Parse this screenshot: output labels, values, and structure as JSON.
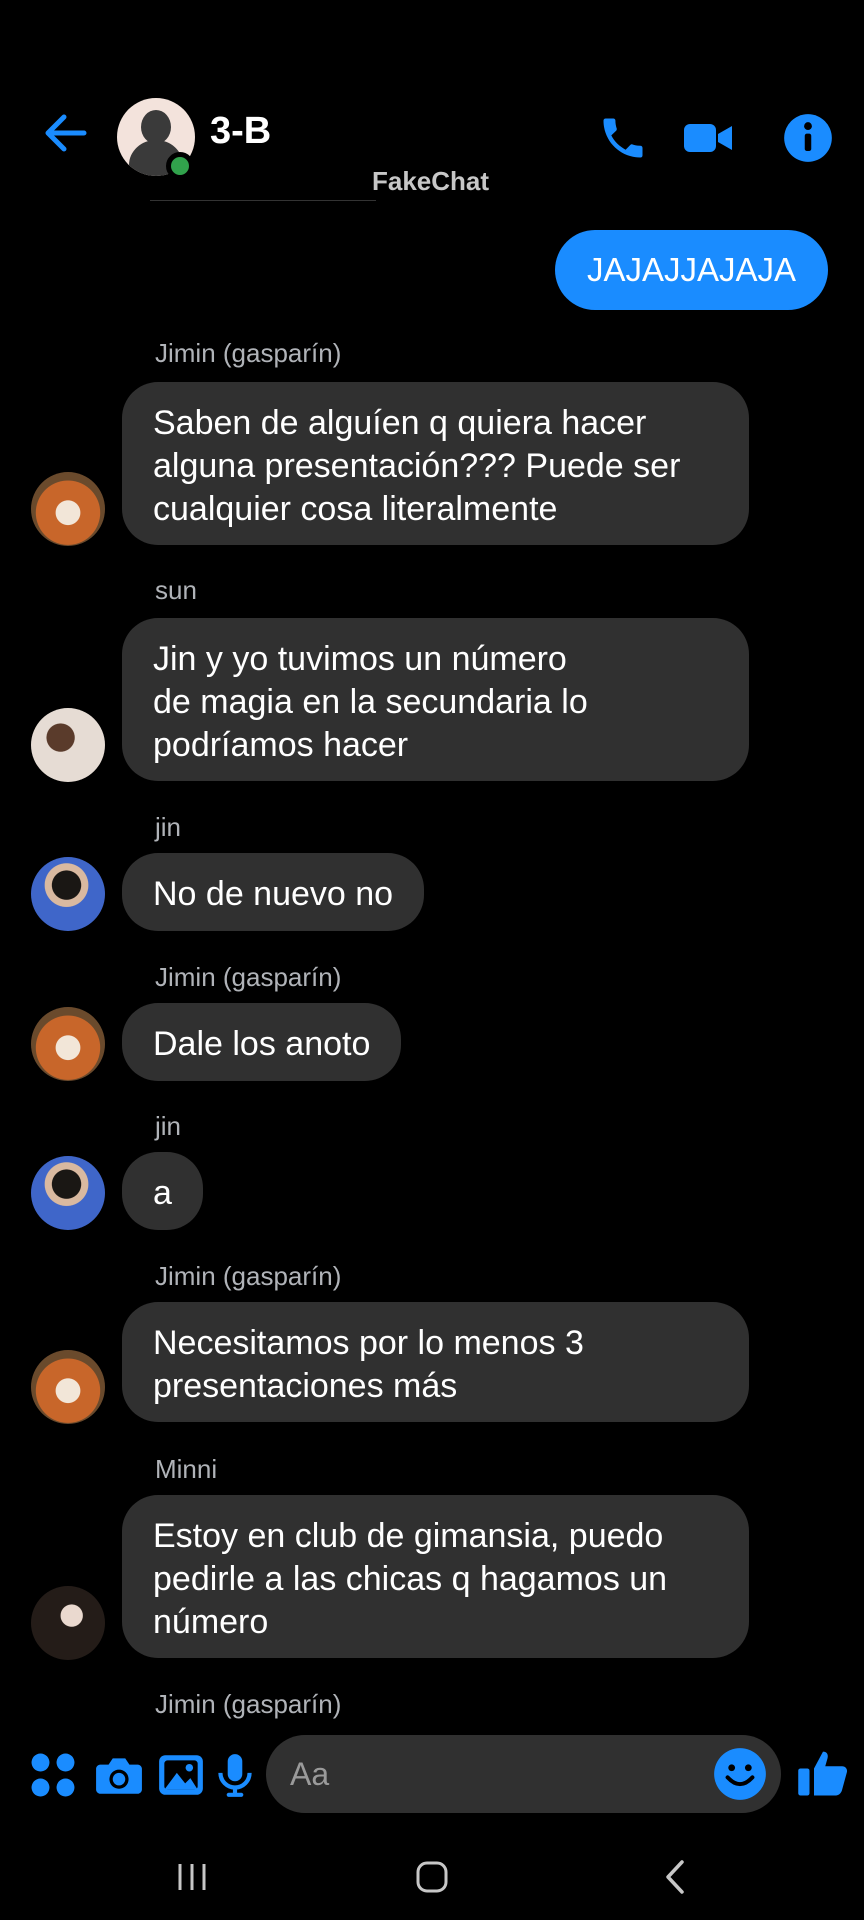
{
  "header": {
    "title": "3-B",
    "watermark": "FakeChat"
  },
  "messages": {
    "sent_1": "JAJAJJAJAJA",
    "m1": {
      "sender": "Jimin (gasparín)",
      "text": "Saben de alguíen q quiera hacer\nalguna presentación??? Puede ser\ncualquier cosa literalmente"
    },
    "m2": {
      "sender": "sun",
      "text": "Jin y yo tuvimos un número\nde magia en la secundaria lo\npodríamos hacer"
    },
    "m3": {
      "sender": "jin",
      "text": "No de nuevo no"
    },
    "m4": {
      "sender": "Jimin (gasparín)",
      "text": "Dale los anoto"
    },
    "m5": {
      "sender": "jin",
      "text": "a"
    },
    "m6": {
      "sender": "Jimin (gasparín)",
      "text": "Necesitamos por lo menos 3\npresentaciones más"
    },
    "m7": {
      "sender": "Minni",
      "text": "Estoy en club de gimansia, puedo\npedirle a las chicas q hagamos un\nnúmero"
    },
    "m8": {
      "sender": "Jimin (gasparín)"
    }
  },
  "composer": {
    "placeholder": "Aa"
  },
  "colors": {
    "accent": "#1a8cff",
    "bubble": "#303030",
    "online": "#31a24c"
  },
  "icons": [
    "back-arrow-icon",
    "phone-icon",
    "video-icon",
    "info-icon",
    "apps-icon",
    "camera-icon",
    "gallery-icon",
    "microphone-icon",
    "emoji-icon",
    "thumbs-up-icon",
    "recent-apps-icon",
    "home-icon",
    "nav-back-icon"
  ]
}
